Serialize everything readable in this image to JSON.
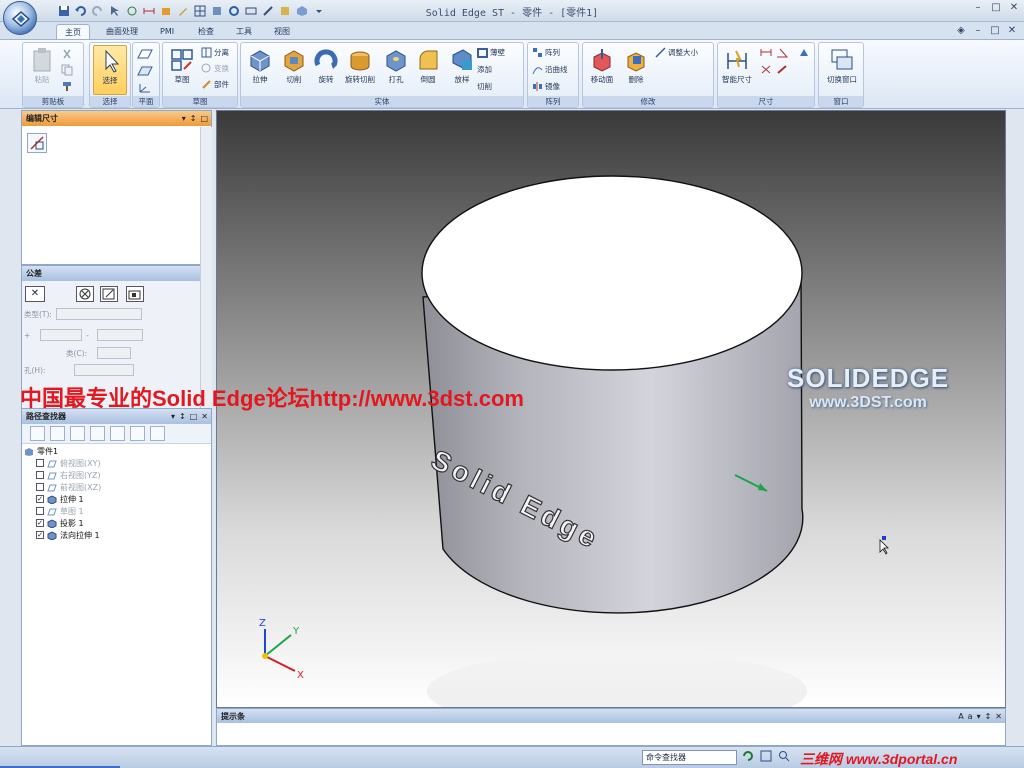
{
  "window": {
    "title": "Solid Edge ST - 零件 - [零件1]"
  },
  "tabs": [
    {
      "label": "主页"
    },
    {
      "label": "曲面处理"
    },
    {
      "label": "PMI"
    },
    {
      "label": "检查"
    },
    {
      "label": "工具"
    },
    {
      "label": "视图"
    }
  ],
  "ribbon": {
    "clipboard": {
      "group": "剪贴板",
      "paste": "粘贴"
    },
    "select": {
      "group": "选择",
      "select": "选择"
    },
    "plane": {
      "group": "平面"
    },
    "sketch": {
      "group": "草图",
      "sketch": "草图",
      "split": "分离",
      "transform": "变换",
      "part": "部件"
    },
    "solid": {
      "group": "实体",
      "extrude": "拉伸",
      "cut": "切削",
      "revolve": "旋转",
      "revcut": "旋转切削",
      "hole": "打孔",
      "round": "倒圆",
      "loft": "放样",
      "thin": "薄壁",
      "add": "添加",
      "cut2": "切削"
    },
    "pattern": {
      "group": "阵列",
      "pattern": "阵列",
      "along": "沿曲线",
      "mirror": "镜像"
    },
    "modify": {
      "group": "修改",
      "move": "移动面",
      "delete": "删除",
      "resize": "调整大小"
    },
    "dimension": {
      "group": "尺寸",
      "smartdim": "智能尺寸"
    },
    "window_grp": {
      "group": "窗口",
      "switch": "切换窗口"
    }
  },
  "panels": {
    "edit_dim": {
      "title": "编辑尺寸"
    },
    "tolerance": {
      "title": "公差",
      "type_label": "类型(T):",
      "plus": "+",
      "minus": "-",
      "class_label": "类(C):",
      "hole_label": "孔(H):"
    },
    "pathfinder": {
      "title": "路径查找器",
      "root": "零件1",
      "items": [
        {
          "label": "俯视图(XY)",
          "checked": false,
          "dim": true
        },
        {
          "label": "右视图(YZ)",
          "checked": false,
          "dim": true
        },
        {
          "label": "前视图(XZ)",
          "checked": false,
          "dim": true
        },
        {
          "label": "拉伸 1",
          "checked": true,
          "dim": false
        },
        {
          "label": "草图 1",
          "checked": false,
          "dim": true
        },
        {
          "label": "投影 1",
          "checked": true,
          "dim": false
        },
        {
          "label": "法向拉伸 1",
          "checked": true,
          "dim": false
        }
      ]
    }
  },
  "viewport": {
    "embossed_text": "Solid Edge",
    "logo_line1": "SOLIDEDGE",
    "logo_line2": "www.3DST.com",
    "axes": {
      "x": "X",
      "y": "Y",
      "z": "Z"
    }
  },
  "watermark": "中国最专业的Solid Edge论坛http://www.3dst.com",
  "hintbar": {
    "title": "提示条"
  },
  "statusbar": {
    "command_finder": "命令查找器",
    "portal": "三维网 www.3dportal.cn"
  },
  "colors": {
    "accent_orange": "#ef9a3a",
    "ribbon_blue": "#dce7f5",
    "watermark_red": "#e3171f"
  }
}
